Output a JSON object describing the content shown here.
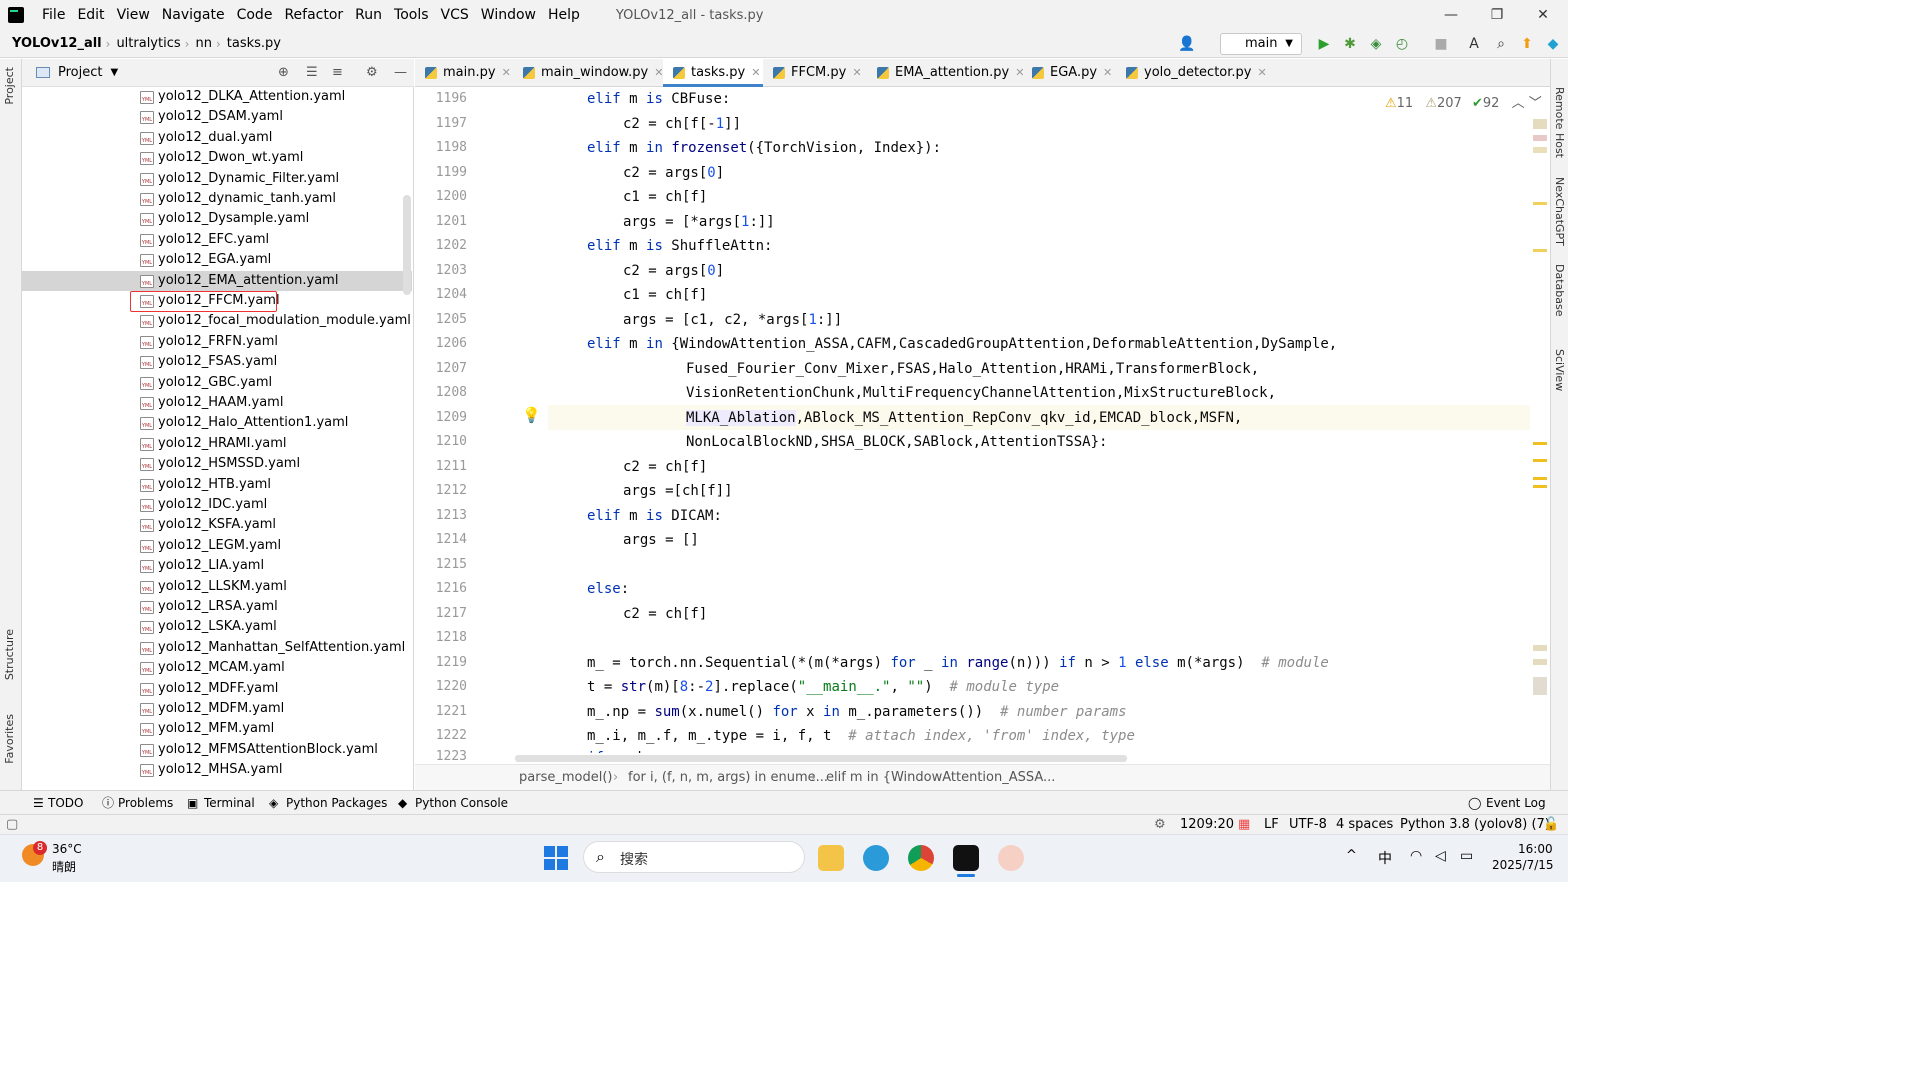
{
  "menubar": {
    "items": [
      "File",
      "Edit",
      "View",
      "Navigate",
      "Code",
      "Refactor",
      "Run",
      "Tools",
      "VCS",
      "Window",
      "Help"
    ],
    "title": "YOLOv12_all - tasks.py",
    "min": "—",
    "restore": "❐",
    "close": "✕"
  },
  "navbar": {
    "crumbs": [
      "YOLOv12_all",
      "ultralytics",
      "nn",
      "tasks.py"
    ],
    "branch": "main"
  },
  "left_strip": {
    "project": "Project",
    "structure": "Structure",
    "favorites": "Favorites"
  },
  "project_panel": {
    "title": "Project",
    "files": [
      "yolo12_DLKA_Attention.yaml",
      "yolo12_DSAM.yaml",
      "yolo12_dual.yaml",
      "yolo12_Dwon_wt.yaml",
      "yolo12_Dynamic_Filter.yaml",
      "yolo12_dynamic_tanh.yaml",
      "yolo12_Dysample.yaml",
      "yolo12_EFC.yaml",
      "yolo12_EGA.yaml",
      "yolo12_EMA_attention.yaml",
      "yolo12_FFCM.yaml",
      "yolo12_focal_modulation_module.yaml",
      "yolo12_FRFN.yaml",
      "yolo12_FSAS.yaml",
      "yolo12_GBC.yaml",
      "yolo12_HAAM.yaml",
      "yolo12_Halo_Attention1.yaml",
      "yolo12_HRAMI.yaml",
      "yolo12_HSMSSD.yaml",
      "yolo12_HTB.yaml",
      "yolo12_IDC.yaml",
      "yolo12_KSFA.yaml",
      "yolo12_LEGM.yaml",
      "yolo12_LIA.yaml",
      "yolo12_LLSKM.yaml",
      "yolo12_LRSA.yaml",
      "yolo12_LSKA.yaml",
      "yolo12_Manhattan_SelfAttention.yaml",
      "yolo12_MCAM.yaml",
      "yolo12_MDFF.yaml",
      "yolo12_MDFM.yaml",
      "yolo12_MFM.yaml",
      "yolo12_MFMSAttentionBlock.yaml",
      "yolo12_MHSA.yaml"
    ],
    "selected_file": "yolo12_EMA_attention.yaml",
    "highlighted_file": "yolo12_FFCM.yaml"
  },
  "tabs": [
    "main.py",
    "main_window.py",
    "tasks.py",
    "FFCM.py",
    "EMA_attention.py",
    "EGA.py",
    "yolo_detector.py"
  ],
  "active_tab": "tasks.py",
  "inspections": {
    "warnings": "11",
    "weak_warnings": "207",
    "ok": "92"
  },
  "editor": {
    "line_numbers": [
      "1196",
      "1197",
      "1198",
      "1199",
      "1200",
      "1201",
      "1202",
      "1203",
      "1204",
      "1205",
      "1206",
      "1207",
      "1208",
      "1209",
      "1210",
      "1211",
      "1212",
      "1213",
      "1214",
      "1215",
      "1216",
      "1217",
      "1218",
      "1219",
      "1220",
      "1221",
      "1222",
      "1223"
    ],
    "current_line": "1209"
  },
  "right_strip": {
    "remote": "Remote Host",
    "chat": "NexChatGPT",
    "db": "Database",
    "sci": "SciView"
  },
  "code_breadcrumb": [
    "parse_model()",
    "for i, (f, n, m, args) in enume...",
    "elif m in {WindowAttention_ASSA..."
  ],
  "bottom_tools": [
    "TODO",
    "Problems",
    "Terminal",
    "Python Packages",
    "Python Console",
    "Event Log"
  ],
  "status": {
    "position": "1209:20",
    "line_sep": "LF",
    "encoding": "UTF-8",
    "indent": "4 spaces",
    "interpreter": "Python 3.8 (yolov8) (7)"
  },
  "taskbar": {
    "temp": "36°C",
    "weather": "晴朗",
    "badge": "8",
    "search_placeholder": "搜索",
    "ime": "中",
    "time": "16:00",
    "date": "2025/7/15"
  }
}
